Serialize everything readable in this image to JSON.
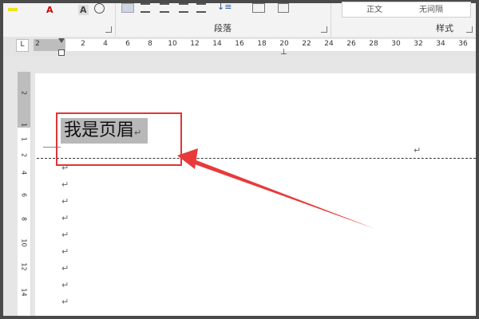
{
  "ribbon": {
    "paragraph_group_label": "段落",
    "styles_group_label": "样式",
    "style_items": [
      "正文",
      "无间隔"
    ],
    "font_buttons": [
      "A",
      "A"
    ]
  },
  "ruler": {
    "tab_selector": "L",
    "horizontal_numbers": [
      "2",
      "2",
      "4",
      "6",
      "8",
      "10",
      "12",
      "14",
      "16",
      "18",
      "20",
      "22",
      "24",
      "26",
      "28",
      "30",
      "32",
      "34",
      "36"
    ],
    "vertical_numbers": [
      "2",
      "1",
      "1",
      "2",
      "4",
      "6",
      "8",
      "10",
      "12",
      "14"
    ]
  },
  "document": {
    "header_text": "我是页眉",
    "paragraph_mark": "↵"
  },
  "annotation": {
    "box_color": "#e03535",
    "arrow_color": "#e83a3a"
  }
}
